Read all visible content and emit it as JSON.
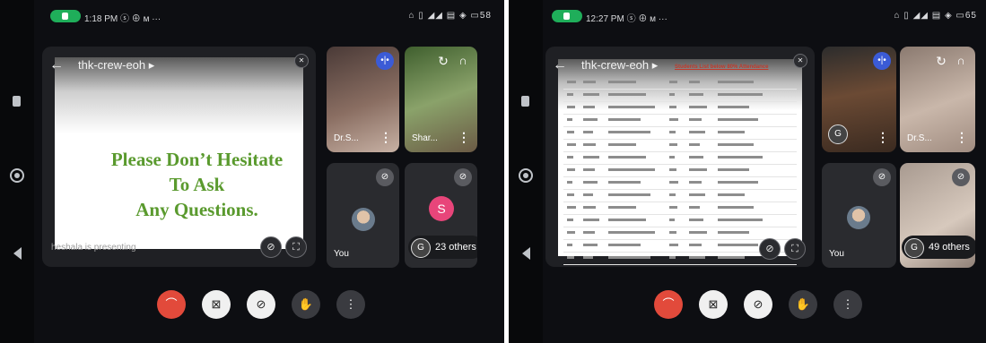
{
  "left": {
    "status_time": "1:18 PM ⓢ ⊕ ᴍ ···",
    "status_right": "⌂ ▯ ◢◢ ▤ ◈ ▭58",
    "meeting_title": "thk-crew-eoh ▸",
    "slide_text_line1": "Please Don’t Hesitate To Ask",
    "slide_text_line2": "Any Questions.",
    "presenting_label": "heshala is presenting",
    "tiles": {
      "top_left_name": "Dr.S...",
      "top_right_name": "Shar...",
      "you_label": "You",
      "others_initial": "S",
      "others_label": "23 others",
      "others_badge": "G"
    }
  },
  "right": {
    "status_time": "12:27 PM ⓢ ⊕ ᴍ ···",
    "status_right": "⌂ ▯ ◢◢ ▤ ◈ ▭65",
    "meeting_title": "thk-crew-eoh ▸",
    "banner_text": "Students List below 80% Attendance",
    "tiles": {
      "top_right_name": "Dr.S...",
      "you_label": "You",
      "others_label": "49 others",
      "others_badge": "G"
    }
  },
  "icons": {
    "back": "←",
    "end_call": "⌒",
    "video_off": "⊠",
    "mic_off": "⊘",
    "hand": "✋",
    "more": "⋮",
    "fullscreen": "⛶"
  },
  "colors": {
    "end_call": "#e24a3b",
    "call_pill": "#1fae5a",
    "slide_text": "#5a9a2e",
    "others_avatar": "#e8457a"
  }
}
